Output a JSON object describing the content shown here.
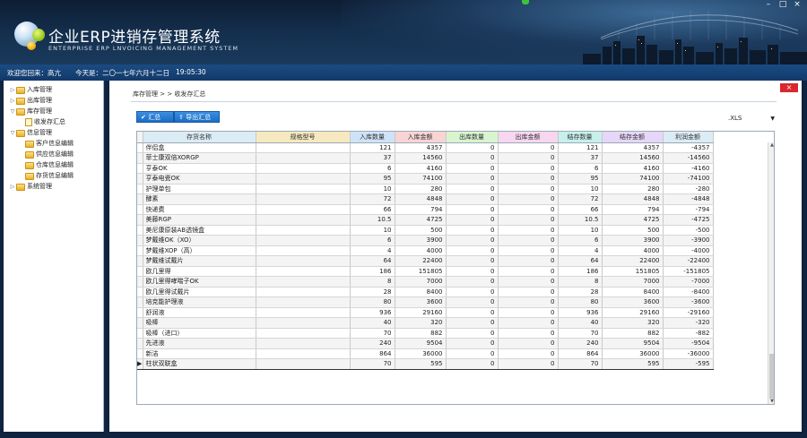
{
  "window": {
    "app_title": "企业ERP进销存管理系统",
    "app_subtitle": "ENTERPRISE ERP LNVOICING  MANAGEMENT SYSTEM",
    "min_label": "–",
    "max_label": "□",
    "close_label": "×"
  },
  "statusbar": {
    "welcome": "欢迎您回来：高亢",
    "date": "今天是：二〇一七年六月十二日",
    "time": "19:05:30"
  },
  "sidebar": {
    "items": [
      {
        "label": "入库管理",
        "toggle": "▷",
        "level": 0,
        "kind": "folder"
      },
      {
        "label": "出库管理",
        "toggle": "▷",
        "level": 0,
        "kind": "folder"
      },
      {
        "label": "库存管理",
        "toggle": "▽",
        "level": 0,
        "kind": "folder"
      },
      {
        "label": "收发存汇总",
        "toggle": "",
        "level": 1,
        "kind": "doc"
      },
      {
        "label": "信息管理",
        "toggle": "▽",
        "level": 0,
        "kind": "folder"
      },
      {
        "label": "客户信息编辑",
        "toggle": "",
        "level": 1,
        "kind": "folder"
      },
      {
        "label": "供应信息编辑",
        "toggle": "",
        "level": 1,
        "kind": "folder"
      },
      {
        "label": "仓库信息编辑",
        "toggle": "",
        "level": 1,
        "kind": "folder"
      },
      {
        "label": "存货信息编辑",
        "toggle": "",
        "level": 1,
        "kind": "folder"
      },
      {
        "label": "系统管理",
        "toggle": "▷",
        "level": 0,
        "kind": "folder"
      }
    ]
  },
  "main": {
    "close_label": "×",
    "breadcrumb": "库存管理 > > 收发存汇总",
    "sum_label": "汇总",
    "export_label": "导出汇总",
    "format_value": ".XLS",
    "columns": [
      {
        "label": "存货名称",
        "color": "#dcecf5"
      },
      {
        "label": "规格型号",
        "color": "#f6e9bf"
      },
      {
        "label": "入库数量",
        "color": "#cfe3f8"
      },
      {
        "label": "入库金额",
        "color": "#f8d4d4"
      },
      {
        "label": "出库数量",
        "color": "#d9f4cf"
      },
      {
        "label": "出库金额",
        "color": "#f7d6ef"
      },
      {
        "label": "结存数量",
        "color": "#c7f0ec"
      },
      {
        "label": "结存金额",
        "color": "#e6d6f7"
      },
      {
        "label": "利润金额",
        "color": "#dcecf5"
      }
    ],
    "rows": [
      [
        "伴侣盒",
        "",
        "121",
        "4357",
        "0",
        "0",
        "121",
        "4357",
        "-4357"
      ],
      [
        "菲士康双倍XORGP",
        "",
        "37",
        "14560",
        "0",
        "0",
        "37",
        "14560",
        "-14560"
      ],
      [
        "亨泰OK",
        "",
        "6",
        "4160",
        "0",
        "0",
        "6",
        "4160",
        "-4160"
      ],
      [
        "亨泰电瓷OK",
        "",
        "95",
        "74100",
        "0",
        "0",
        "95",
        "74100",
        "-74100"
      ],
      [
        "护理单包",
        "",
        "10",
        "280",
        "0",
        "0",
        "10",
        "280",
        "-280"
      ],
      [
        "酵素",
        "",
        "72",
        "4848",
        "0",
        "0",
        "72",
        "4848",
        "-4848"
      ],
      [
        "快递费",
        "",
        "66",
        "794",
        "0",
        "0",
        "66",
        "794",
        "-794"
      ],
      [
        "美藤RGP",
        "",
        "10.5",
        "4725",
        "0",
        "0",
        "10.5",
        "4725",
        "-4725"
      ],
      [
        "美尼康原装AB透镜盒",
        "",
        "10",
        "500",
        "0",
        "0",
        "10",
        "500",
        "-500"
      ],
      [
        "梦戴维OK（XO）",
        "",
        "6",
        "3900",
        "0",
        "0",
        "6",
        "3900",
        "-3900"
      ],
      [
        "梦戴维XOP（高）",
        "",
        "4",
        "4000",
        "0",
        "0",
        "4",
        "4000",
        "-4000"
      ],
      [
        "梦戴维试戴片",
        "",
        "64",
        "22400",
        "0",
        "0",
        "64",
        "22400",
        "-22400"
      ],
      [
        "欧几里得",
        "",
        "186",
        "151805",
        "0",
        "0",
        "186",
        "151805",
        "-151805"
      ],
      [
        "欧几里得哮喘子OK",
        "",
        "8",
        "7000",
        "0",
        "0",
        "8",
        "7000",
        "-7000"
      ],
      [
        "欧几里得试戴片",
        "",
        "28",
        "8400",
        "0",
        "0",
        "28",
        "8400",
        "-8400"
      ],
      [
        "培克能护理液",
        "",
        "80",
        "3600",
        "0",
        "0",
        "80",
        "3600",
        "-3600"
      ],
      [
        "舒润液",
        "",
        "936",
        "29160",
        "0",
        "0",
        "936",
        "29160",
        "-29160"
      ],
      [
        "吸棒",
        "",
        "40",
        "320",
        "0",
        "0",
        "40",
        "320",
        "-320"
      ],
      [
        "吸棒（进口）",
        "",
        "70",
        "882",
        "0",
        "0",
        "70",
        "882",
        "-882"
      ],
      [
        "先进液",
        "",
        "240",
        "9504",
        "0",
        "0",
        "240",
        "9504",
        "-9504"
      ],
      [
        "新洁",
        "",
        "864",
        "36000",
        "0",
        "0",
        "864",
        "36000",
        "-36000"
      ],
      [
        "柱状双联盒",
        "",
        "70",
        "595",
        "0",
        "0",
        "70",
        "595",
        "-595"
      ]
    ],
    "current_row_marker": "▶"
  }
}
